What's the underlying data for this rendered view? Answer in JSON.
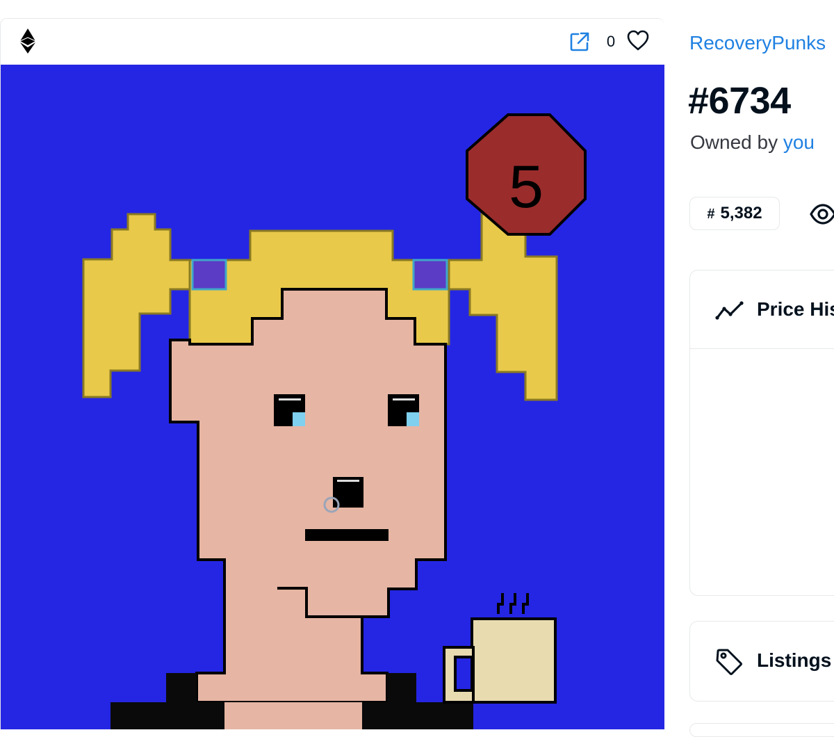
{
  "card": {
    "chain_icon": "ethereum-icon",
    "external_link_icon": "external-link-icon",
    "favorites_count": "0",
    "favorite_icon": "heart-icon"
  },
  "artwork": {
    "background": "#2526e3",
    "badge_text": "5",
    "colors": {
      "hair": "#e8c94a",
      "skin": "#e6b5a4",
      "badge": "#9b2c2c",
      "mug": "#e8dbb0",
      "outline": "#000000",
      "clip": "#5b3cc4",
      "tear": "#7fd0ee"
    }
  },
  "item": {
    "collection": "RecoveryPunks",
    "title": "#6734",
    "owned_by_prefix": "Owned by ",
    "owner": "you",
    "rank_symbol": "#",
    "rank": "5,382",
    "views_icon": "eye-icon"
  },
  "panels": {
    "price_history_label": "Price History",
    "price_history_icon": "trend-line-icon",
    "listings_label": "Listings",
    "listings_icon": "tag-icon"
  }
}
